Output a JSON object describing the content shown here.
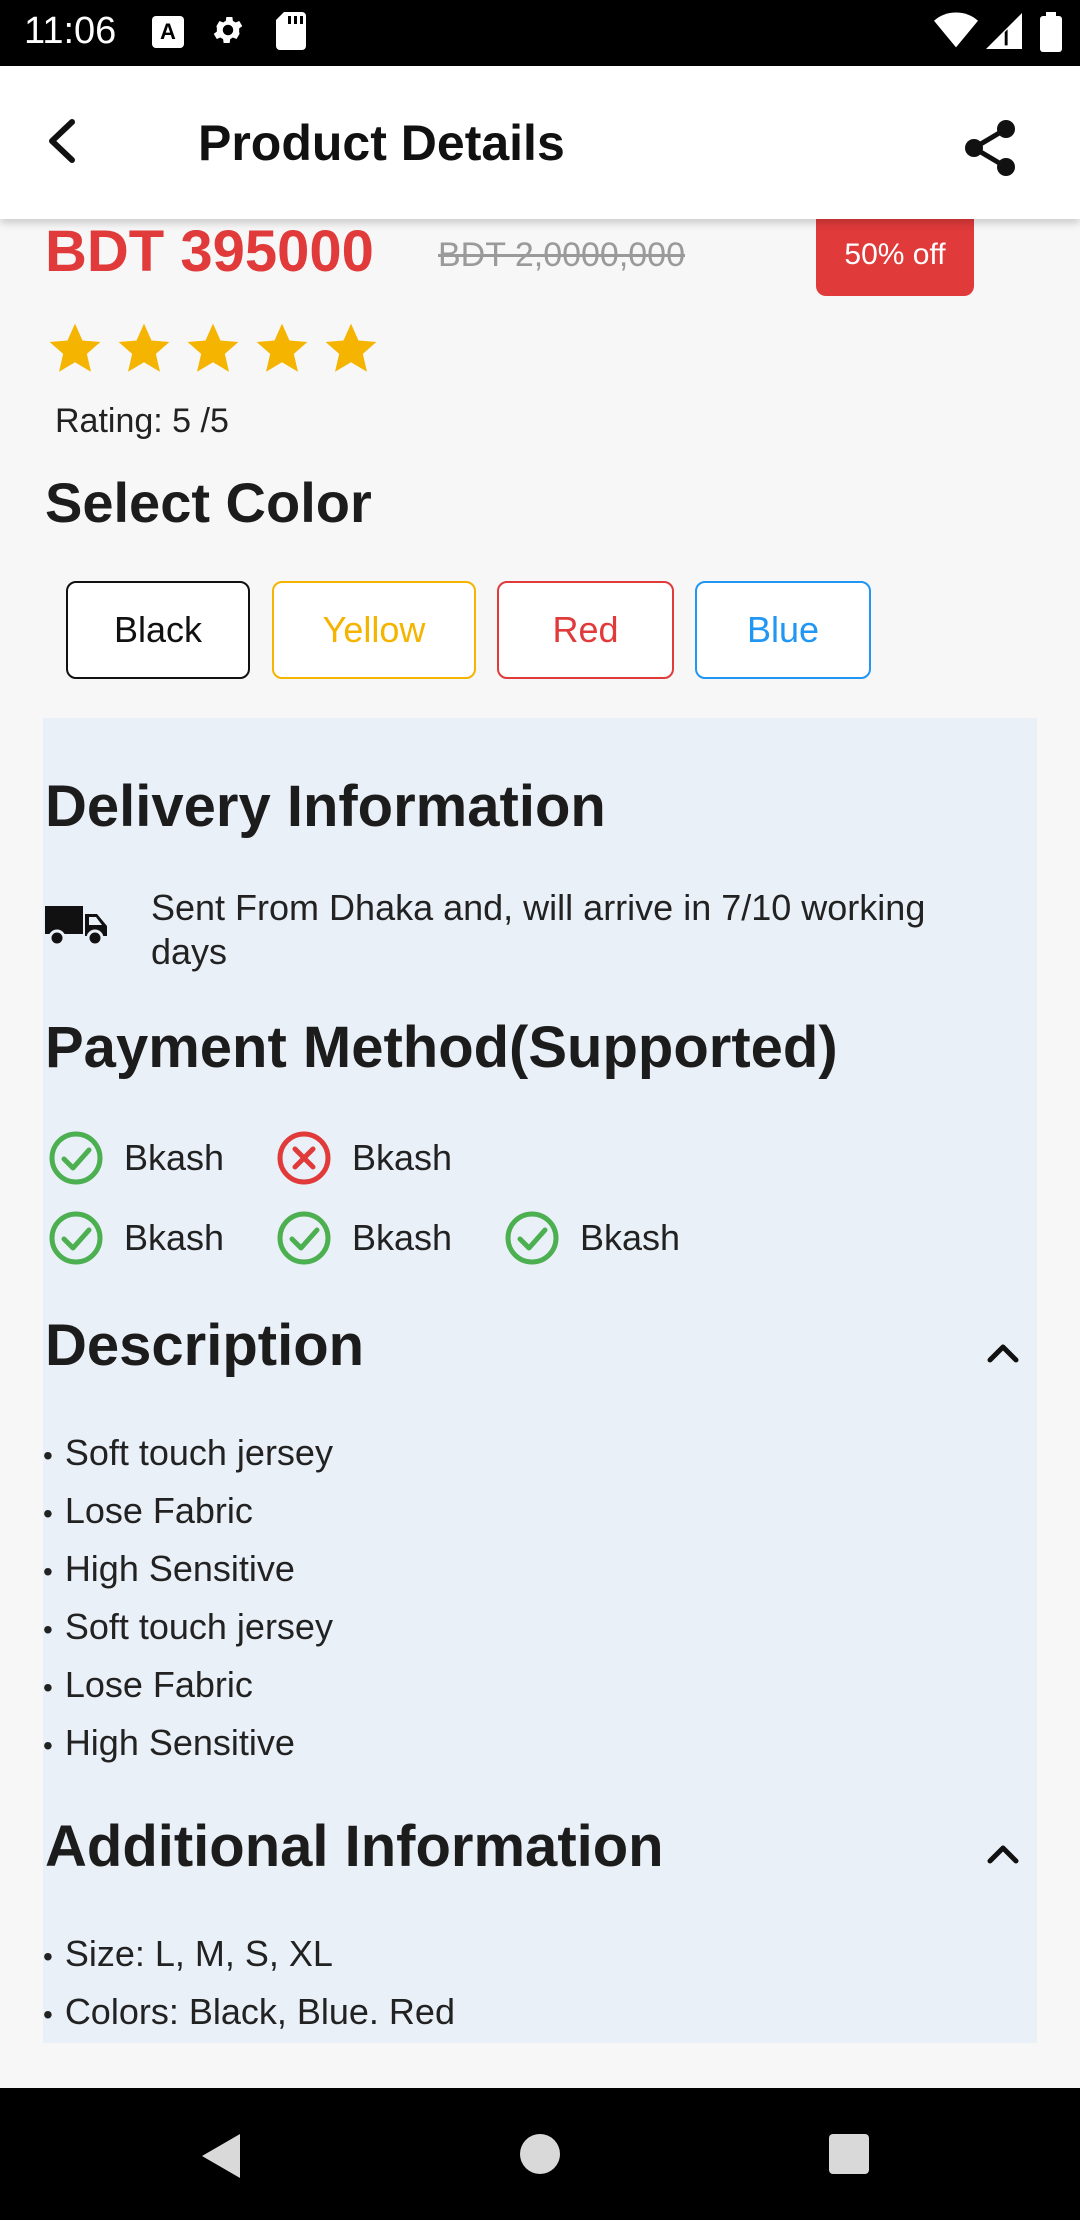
{
  "status_bar": {
    "time": "11:06",
    "icons": [
      "a-icon",
      "gear-icon",
      "sd-card-icon",
      "wifi-icon",
      "signal-icon",
      "battery-icon"
    ],
    "a_glyph": "A"
  },
  "app_bar": {
    "title": "Product Details",
    "back_icon": "back-arrow-icon",
    "share_icon": "share-icon"
  },
  "product": {
    "price": "BDT 395000",
    "old_price": "BDT 2,0000,000",
    "discount": "50% off",
    "rating_stars": 5,
    "rating_text": "Rating: 5 /5"
  },
  "select_color": {
    "title": "Select Color",
    "options": [
      {
        "label": "Black",
        "color": "#111111"
      },
      {
        "label": "Yellow",
        "color": "#f4b400"
      },
      {
        "label": "Red",
        "color": "#e03a3a"
      },
      {
        "label": "Blue",
        "color": "#2196f3"
      }
    ]
  },
  "delivery": {
    "title": "Delivery Information",
    "text": "Sent From Dhaka and, will arrive in 7/10 working days"
  },
  "payment": {
    "title": "Payment Method(Supported)",
    "methods": [
      {
        "label": "Bkash",
        "supported": true
      },
      {
        "label": "Bkash",
        "supported": false
      },
      {
        "label": "Bkash",
        "supported": true
      },
      {
        "label": "Bkash",
        "supported": true
      },
      {
        "label": "Bkash",
        "supported": true
      }
    ]
  },
  "description": {
    "title": "Description",
    "items": [
      "Soft touch jersey",
      "Lose Fabric",
      "High Sensitive",
      "Soft touch jersey",
      "Lose Fabric",
      "High Sensitive"
    ]
  },
  "additional": {
    "title": "Additional Information",
    "items": [
      "Size: L, M, S, XL",
      "Colors: Black, Blue. Red"
    ]
  },
  "colors": {
    "accent_red": "#e03a3a",
    "star": "#f4b400",
    "check_green": "#4caf50",
    "panel_bg": "#eaf0f8"
  },
  "bullet": "•",
  "nav_bar": {
    "buttons": [
      "nav-back-button",
      "nav-home-button",
      "nav-recents-button"
    ]
  }
}
